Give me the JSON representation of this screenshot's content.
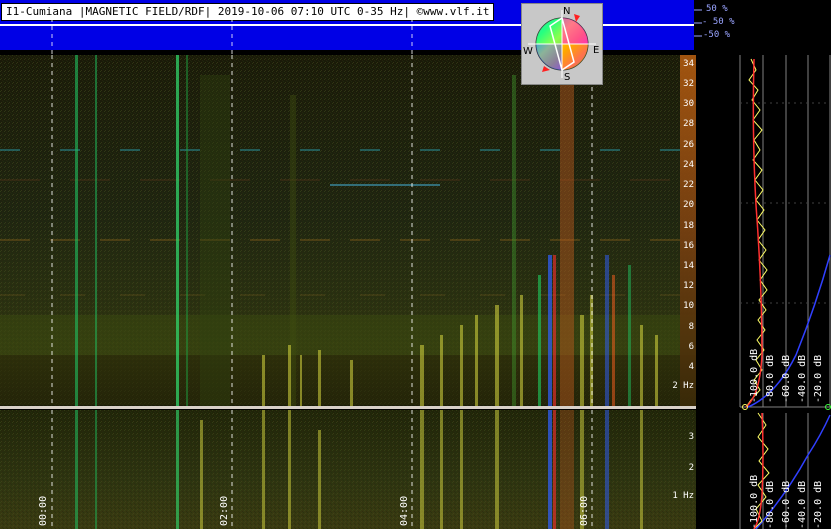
{
  "header": {
    "title": "I1-Cumiana |MAGNETIC FIELD/RDF| 2019-10-06 07:10 UTC 0-35 Hz| ©www.vlf.it"
  },
  "percent_scale": [
    "50 %",
    "- 50 %",
    "-50 %"
  ],
  "compass": {
    "north": "N",
    "south": "S",
    "east": "E",
    "west": "W"
  },
  "frequency_axis_top": [
    "34",
    "32",
    "30",
    "28",
    "26",
    "24",
    "22",
    "20",
    "18",
    "16",
    "14",
    "12",
    "10",
    "8",
    "6",
    "4",
    "2 Hz"
  ],
  "frequency_axis_bottom": [
    "3",
    "2",
    "1 Hz"
  ],
  "time_axis": [
    "00:00",
    "02:00",
    "04:00",
    "06:00"
  ],
  "db_scale_top": [
    "-100.0 dB",
    "-80.0 dB",
    "-60.0 dB",
    "-40.0 dB",
    "-20.0 dB"
  ],
  "db_scale_bottom": [
    "-100.0 dB",
    "-80.0 dB",
    "-60.0 dB",
    "-40.0 dB",
    "-20.0 dB"
  ],
  "colors": {
    "top_strip": "#0000e6",
    "background": "#000000",
    "trace_yellow": "#ffff66",
    "trace_red": "#ff3030",
    "trace_blue": "#3040ff"
  }
}
